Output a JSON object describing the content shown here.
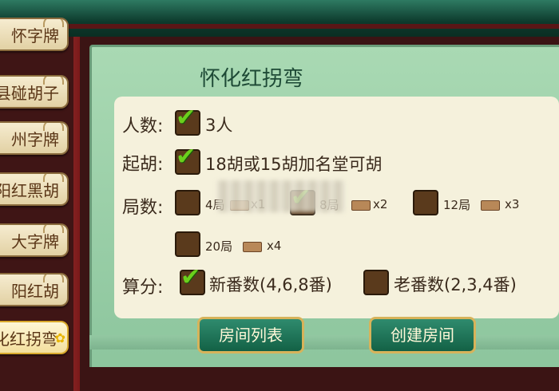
{
  "sidebar": {
    "items": [
      {
        "label": "怀字牌"
      },
      {
        "label": "县碰胡子"
      },
      {
        "label": "州字牌"
      },
      {
        "label": "阳红黑胡"
      },
      {
        "label": "大字牌"
      },
      {
        "label": "阳红胡"
      },
      {
        "label": "化红拐弯",
        "active": true
      }
    ]
  },
  "panel": {
    "title": "怀化红拐弯",
    "players": {
      "label": "人数:",
      "option": "3人",
      "checked": true
    },
    "start_hu": {
      "label": "起胡:",
      "option": "18胡或15胡加名堂可胡",
      "checked": true
    },
    "rounds": {
      "label": "局数:",
      "options": [
        {
          "text": "4局",
          "mult": "x1",
          "checked": false
        },
        {
          "text": "8局",
          "mult": "x2",
          "checked": true
        },
        {
          "text": "12局",
          "mult": "x3",
          "checked": false
        },
        {
          "text": "20局",
          "mult": "x4",
          "checked": false
        }
      ]
    },
    "scoring": {
      "label": "算分:",
      "options": [
        {
          "text": "新番数(4,6,8番)",
          "checked": true
        },
        {
          "text": "老番数(2,3,4番)",
          "checked": false
        }
      ]
    }
  },
  "buttons": {
    "room_list": "房间列表",
    "create_room": "创建房间"
  },
  "colors": {
    "accent_green": "#6bd01c",
    "button_green": "#1f7457",
    "panel_green": "#9ccfa9"
  }
}
